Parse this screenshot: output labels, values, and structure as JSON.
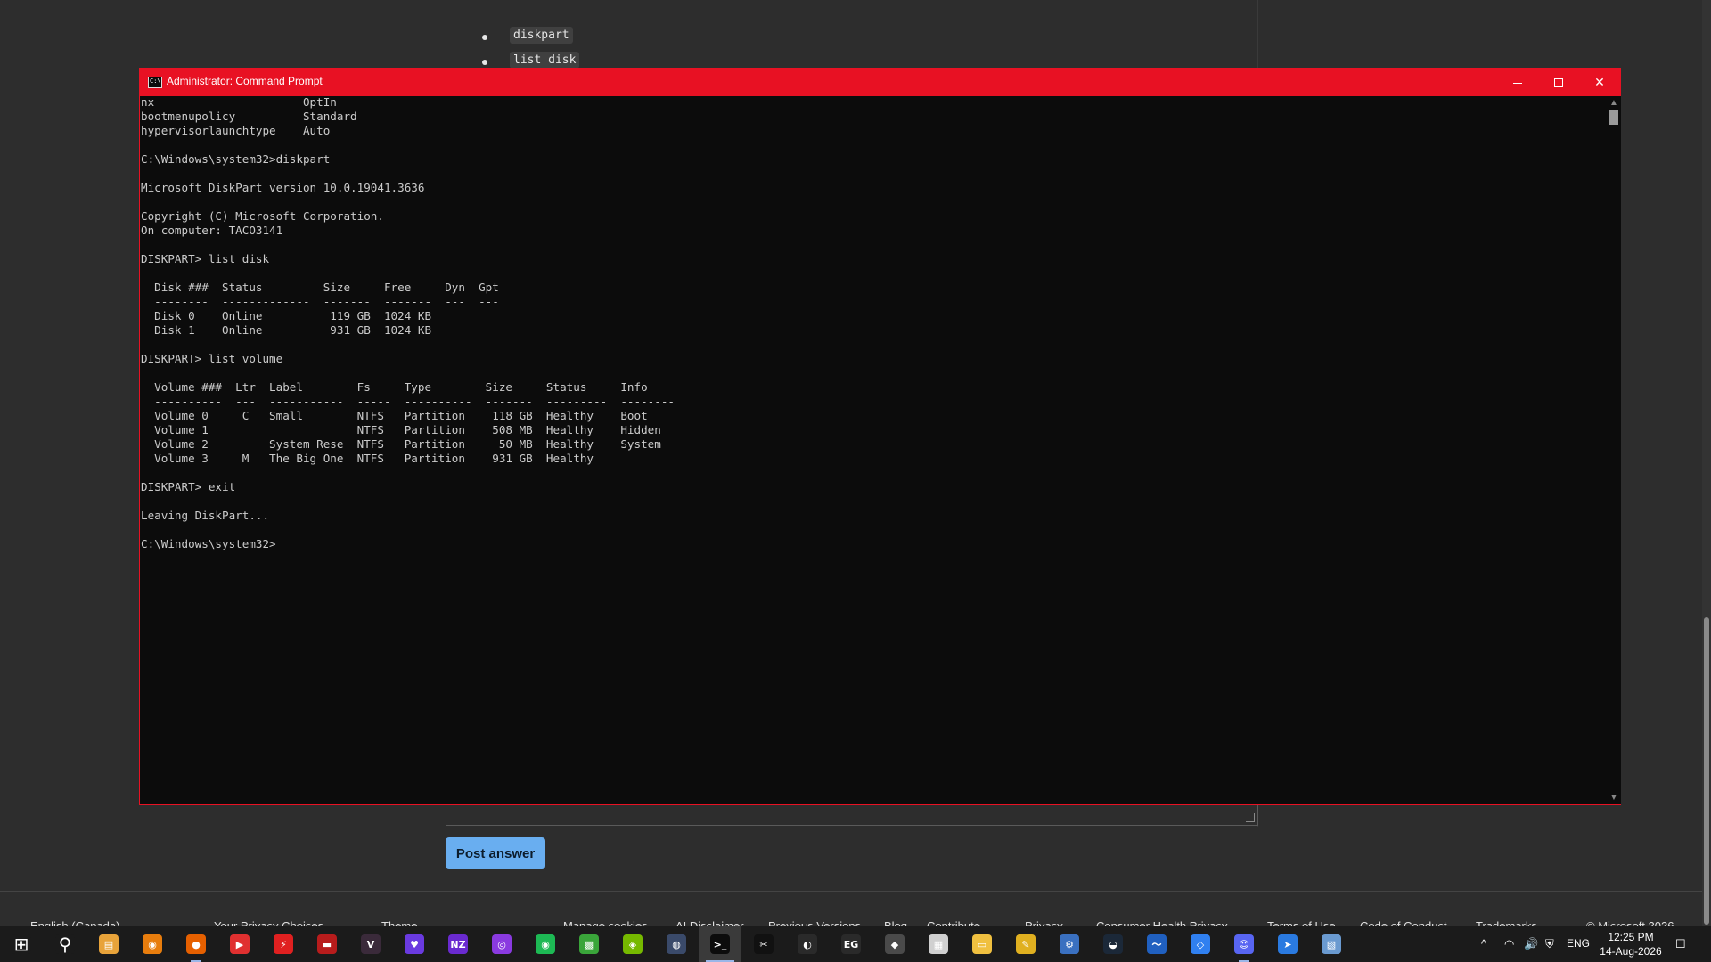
{
  "browser_page": {
    "bullets": [
      "diskpart",
      "list disk"
    ],
    "post_button": "Post answer",
    "footer": {
      "language": "English (Canada)",
      "privacy": "Your Privacy Choices",
      "theme": "Theme",
      "links": [
        "Manage cookies",
        "AI Disclaimer",
        "Previous Versions",
        "Blog",
        "Contribute",
        "Privacy",
        "Consumer Health Privacy",
        "Terms of Use",
        "Code of Conduct",
        "Trademarks",
        "© Microsoft 2026"
      ]
    }
  },
  "cmd_window": {
    "title": "Administrator: Command Prompt",
    "minimize_glyph": "—",
    "maximize_glyph": "☐",
    "close_glyph": "✕",
    "lines": [
      "nx                      OptIn",
      "bootmenupolicy          Standard",
      "hypervisorlaunchtype    Auto",
      "",
      "C:\\Windows\\system32>diskpart",
      "",
      "Microsoft DiskPart version 10.0.19041.3636",
      "",
      "Copyright (C) Microsoft Corporation.",
      "On computer: TACO3141",
      "",
      "DISKPART> list disk",
      "",
      "  Disk ###  Status         Size     Free     Dyn  Gpt",
      "  --------  -------------  -------  -------  ---  ---",
      "  Disk 0    Online          119 GB  1024 KB",
      "  Disk 1    Online          931 GB  1024 KB",
      "",
      "DISKPART> list volume",
      "",
      "  Volume ###  Ltr  Label        Fs     Type        Size     Status     Info",
      "  ----------  ---  -----------  -----  ----------  -------  ---------  --------",
      "  Volume 0     C   Small        NTFS   Partition    118 GB  Healthy    Boot",
      "  Volume 1                      NTFS   Partition    508 MB  Healthy    Hidden",
      "  Volume 2         System Rese  NTFS   Partition     50 MB  Healthy    System",
      "  Volume 3     M   The Big One  NTFS   Partition    931 GB  Healthy",
      "",
      "DISKPART> exit",
      "",
      "Leaving DiskPart...",
      "",
      "C:\\Windows\\system32>"
    ]
  },
  "taskbar": {
    "apps": [
      {
        "name": "start-icon",
        "glyph": "⊞",
        "color": "#1b1b1b"
      },
      {
        "name": "search-icon",
        "glyph": "⚲",
        "color": "#1b1b1b"
      },
      {
        "name": "file-folder-icon",
        "glyph": "▤",
        "color": "#e8a33a"
      },
      {
        "name": "blender-icon",
        "glyph": "◉",
        "color": "#e87d0d"
      },
      {
        "name": "firefox-icon",
        "glyph": "●",
        "color": "#e66000"
      },
      {
        "name": "media-app-icon",
        "glyph": "▶",
        "color": "#e03030"
      },
      {
        "name": "thunder-app-icon",
        "glyph": "⚡",
        "color": "#e02020"
      },
      {
        "name": "red-game-icon",
        "glyph": "▬",
        "color": "#b81c1c"
      },
      {
        "name": "v-app-icon",
        "glyph": "V",
        "color": "#3a2a3a"
      },
      {
        "name": "heart-app-icon",
        "glyph": "♥",
        "color": "#6a3ae0"
      },
      {
        "name": "nzxt-icon",
        "glyph": "NZ",
        "color": "#6a2ad0"
      },
      {
        "name": "purple-circle-icon",
        "glyph": "◎",
        "color": "#8a3ae0"
      },
      {
        "name": "spotify-icon",
        "glyph": "◉",
        "color": "#1db954"
      },
      {
        "name": "minecraft-icon",
        "glyph": "▩",
        "color": "#3aa53a"
      },
      {
        "name": "nvidia-icon",
        "glyph": "◈",
        "color": "#76b900"
      },
      {
        "name": "resolve-icon",
        "glyph": "◍",
        "color": "#3a4a6a"
      },
      {
        "name": "terminal-icon",
        "glyph": ">_",
        "color": "#0c0c0c"
      },
      {
        "name": "capcut-icon",
        "glyph": "✂",
        "color": "#111111"
      },
      {
        "name": "obs-icon",
        "glyph": "◐",
        "color": "#2a2a2a"
      },
      {
        "name": "epic-games-icon",
        "glyph": "EG",
        "color": "#2a2a2a"
      },
      {
        "name": "unity-icon",
        "glyph": "◆",
        "color": "#4a4a4a"
      },
      {
        "name": "notepad-icon",
        "glyph": "▦",
        "color": "#d0d0d0"
      },
      {
        "name": "explorer-icon",
        "glyph": "▭",
        "color": "#f0c040"
      },
      {
        "name": "paint-icon",
        "glyph": "✎",
        "color": "#e0b020"
      },
      {
        "name": "python-icon",
        "glyph": "⚙",
        "color": "#3a70c0"
      },
      {
        "name": "steam-icon",
        "glyph": "◒",
        "color": "#1b2838"
      },
      {
        "name": "health-app-icon",
        "glyph": "〜",
        "color": "#2060c0"
      },
      {
        "name": "roblox-icon",
        "glyph": "◇",
        "color": "#3080f0"
      },
      {
        "name": "discord-icon",
        "glyph": "☺",
        "color": "#5865f2"
      },
      {
        "name": "remote-app-icon",
        "glyph": "➤",
        "color": "#2a7ae0"
      },
      {
        "name": "blue-app-icon",
        "glyph": "▧",
        "color": "#6a9ad0"
      }
    ],
    "tray": {
      "chevron": "^",
      "network": "◠",
      "volume": "🔊",
      "security": "⛨",
      "lang": "ENG",
      "time": "12:25 PM",
      "date": "14-Aug-2026",
      "notifications": "☐"
    }
  }
}
